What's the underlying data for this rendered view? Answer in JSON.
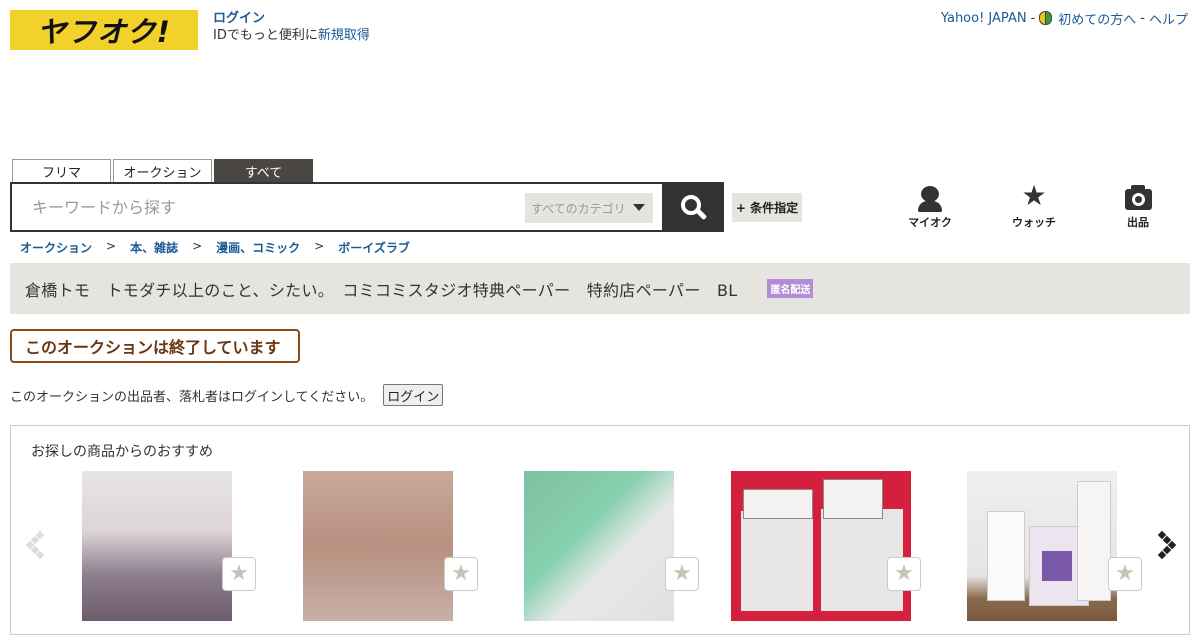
{
  "header": {
    "logo_text": "ヤフオク!",
    "login_label": "ログイン",
    "id_text": "IDでもっと便利に",
    "signup_label": "新規取得",
    "yahoo_japan": "Yahoo! JAPAN",
    "beginner_label": "初めての方へ",
    "help_label": "ヘルプ",
    "separator": "-"
  },
  "search": {
    "tabs": [
      {
        "label": "フリマ",
        "active": false
      },
      {
        "label": "オークション",
        "active": false
      },
      {
        "label": "すべて",
        "active": true
      }
    ],
    "placeholder": "キーワードから探す",
    "category": "すべてのカテゴリ",
    "condition_label": "+ 条件指定"
  },
  "nav_icons": {
    "myauction": "マイオク",
    "watch": "ウォッチ",
    "sell": "出品"
  },
  "breadcrumb": [
    "オークション",
    "本、雑誌",
    "漫画、コミック",
    "ボーイズラブ"
  ],
  "breadcrumb_sep": ">",
  "item": {
    "title": "倉橋トモ　トモダチ以上のこと、シたい。　コミコミスタジオ特典ペーパー　特約店ペーパー　BL",
    "badge": "匿名配送"
  },
  "status": {
    "ended_text": "このオークションは終了しています",
    "login_note": "このオークションの出品者、落札者はログインしてください。",
    "login_button": "ログイン"
  },
  "recommend": {
    "title": "お探しの商品からのおすすめ",
    "star_glyph": "★"
  },
  "colors": {
    "logo_bg": "#f2d12b",
    "link": "#1b5a96",
    "ended_border": "#8b4a17",
    "badge": "#b48dd6",
    "bar_bg": "#e6e4df"
  }
}
